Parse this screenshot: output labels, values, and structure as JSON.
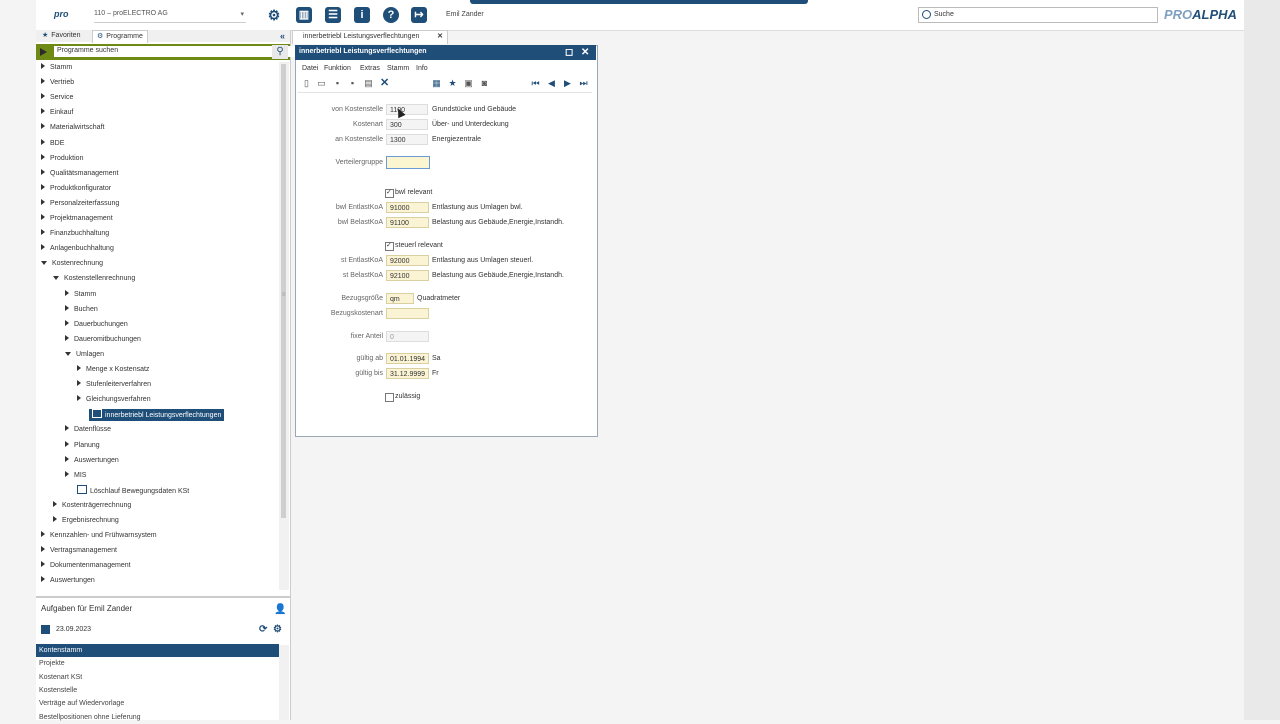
{
  "topbar": {
    "logo": "pro",
    "company": "110 – proELECTRO AG",
    "company_caret": "▾",
    "user": "Emil Zander",
    "search_label": "Suche",
    "brand_pro": "PRO",
    "brand_alpha": "ALPHA"
  },
  "left": {
    "tab_favorites": "Favoriten",
    "tab_programs": "Programme",
    "program_search_placeholder": "Programme suchen",
    "tree": [
      "Stamm",
      "Vertrieb",
      "Service",
      "Einkauf",
      "Materialwirtschaft",
      "BDE",
      "Produktion",
      "Qualitätsmanagement",
      "Produktkonfigurator",
      "Personalzeiterfassung",
      "Projektmanagement",
      "Finanzbuchhaltung",
      "Anlagenbuchhaltung",
      "Kostenrechnung",
      "Kostenstellenrechnung",
      "Stamm",
      "Buchen",
      "Dauerbuchungen",
      "Daueromitbuchungen",
      "Umlagen",
      "Menge x Kostensatz",
      "Stufenleiterverfahren",
      "Gleichungsverfahren",
      "innerbetriebl Leistungsverflechtungen",
      "Datenflüsse",
      "Planung",
      "Auswertungen",
      "MIS",
      "Löschlauf Bewegungsdaten KSt",
      "Kostenträgerrechnung",
      "Ergebnisrechnung",
      "Kennzahlen- und Frühwarnsystem",
      "Vertragsmanagement",
      "Dokumentenmanagement",
      "Auswertungen"
    ],
    "tasks_title": "Aufgaben für Emil Zander",
    "tasks_date": "23.09.2023",
    "tasks": [
      "Kontenstamm",
      "Projekte",
      "Kostenart KSt",
      "Kostenstelle",
      "Verträge auf Wiedervorlage",
      "Bestellpositionen ohne Lieferung"
    ]
  },
  "window": {
    "tab_label": "innerbetriebl Leistungsverflechtungen",
    "title": "innerbetriebl Leistungsverflechtungen",
    "menus": [
      "Datei",
      "Funktion",
      "Extras",
      "Stamm",
      "Info"
    ],
    "fields": {
      "von_kostenstelle_label": "von Kostenstelle",
      "von_kostenstelle": "1100",
      "von_kostenstelle_desc": "Grundstücke und Gebäude",
      "kostenart_label": "Kostenart",
      "kostenart": "300",
      "kostenart_desc": "Über- und Unterdeckung",
      "an_kostenstelle_label": "an Kostenstelle",
      "an_kostenstelle": "1300",
      "an_kostenstelle_desc": "Energiezentrale",
      "verteilergruppe_label": "Verteilergruppe",
      "verteilergruppe": "",
      "bwl_relevant": "bwl relevant",
      "bwl_entlast_label": "bwl EntlastKoA",
      "bwl_entlast": "91000",
      "bwl_entlast_desc": "Entlastung aus Umlagen bwl.",
      "bwl_belast_label": "bwl BelastKoA",
      "bwl_belast": "91100",
      "bwl_belast_desc": "Belastung aus Gebäude,Energie,Instandh.",
      "steuerl_relevant": "steuerl relevant",
      "st_entlast_label": "st EntlastKoA",
      "st_entlast": "92000",
      "st_entlast_desc": "Entlastung aus Umlagen steuerl.",
      "st_belast_label": "st BelastKoA",
      "st_belast": "92100",
      "st_belast_desc": "Belastung aus Gebäude,Energie,Instandh.",
      "bezugsgroesse_label": "Bezugsgröße",
      "bezugsgroesse": "qm",
      "bezugsgroesse_desc": "Quadratmeter",
      "bezugskostenart_label": "Bezugskostenart",
      "bezugskostenart": "",
      "fixer_anteil_label": "fixer Anteil",
      "fixer_anteil": "0",
      "gueltig_ab_label": "gültig ab",
      "gueltig_ab": "01.01.1994",
      "gueltig_ab_day": "Sa",
      "gueltig_bis_label": "gültig bis",
      "gueltig_bis": "31.12.9999",
      "gueltig_bis_day": "Fr",
      "zulaessig": "zulässig"
    }
  }
}
